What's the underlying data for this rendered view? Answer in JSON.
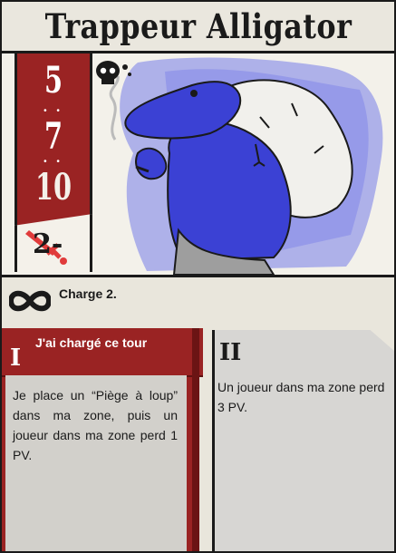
{
  "card": {
    "title": "Trappeur Alligator",
    "stats": [
      "5",
      "7",
      "10"
    ],
    "damage": "2-",
    "keyword": "Charge 2.",
    "ability1": {
      "numeral": "I",
      "header": "J'ai chargé ce tour",
      "text": "Je place un “Piège à loup” dans ma zone, puis un joueur dans ma zone perd 1 PV."
    },
    "ability2": {
      "numeral": "II",
      "text": "Un joueur dans ma zone perd 3 PV."
    },
    "icons": [
      "skull-icon",
      "infinity-icon",
      "sword-icon"
    ],
    "colors": {
      "accent_red": "#9a2323",
      "paint_blue": "#4c4fd6",
      "paper": "#e9e6dc"
    }
  }
}
